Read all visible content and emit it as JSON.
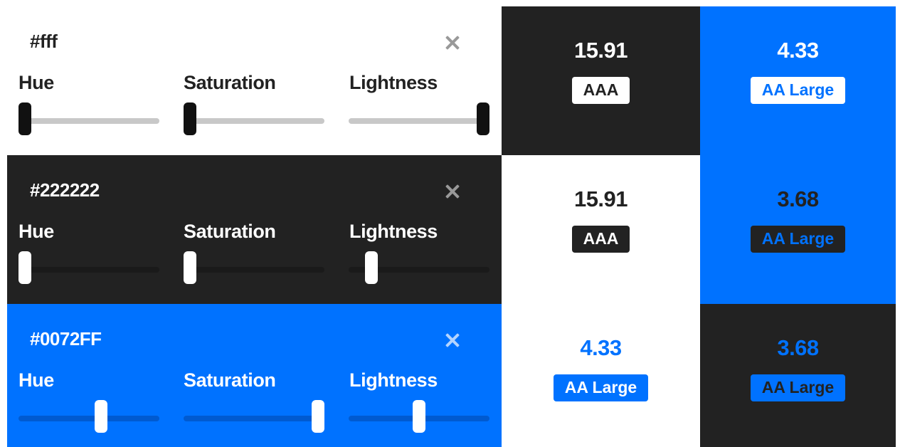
{
  "slider_labels": {
    "hue": "Hue",
    "saturation": "Saturation",
    "lightness": "Lightness"
  },
  "colors": [
    {
      "hex": "#fff",
      "background": "#ffffff",
      "text_color": "#222222",
      "close_color": "#999999",
      "track_color": "#c8c8c8",
      "thumb_color": "#111111",
      "hue": 0,
      "saturation": 0,
      "lightness": 100
    },
    {
      "hex": "#222222",
      "background": "#222222",
      "text_color": "#ffffff",
      "close_color": "#999999",
      "track_color": "#1a1a1a",
      "thumb_color": "#ffffff",
      "hue": 0,
      "saturation": 0,
      "lightness": 13
    },
    {
      "hex": "#0072FF",
      "background": "#0072ff",
      "text_color": "#ffffff",
      "close_color": "#b3d4ff",
      "track_color": "#005ad0",
      "thumb_color": "#ffffff",
      "hue": 213,
      "saturation": 100,
      "lightness": 50
    }
  ],
  "contrast_grid": [
    {
      "ratio": "15.91",
      "badge": "AAA",
      "background": "#222222",
      "text_color": "#ffffff",
      "badge_background": "#ffffff",
      "badge_text": "#222222"
    },
    {
      "ratio": "4.33",
      "badge": "AA Large",
      "background": "#0072ff",
      "text_color": "#ffffff",
      "badge_background": "#ffffff",
      "badge_text": "#0072ff"
    },
    {
      "ratio": "15.91",
      "badge": "AAA",
      "background": "#ffffff",
      "text_color": "#222222",
      "badge_background": "#222222",
      "badge_text": "#ffffff"
    },
    {
      "ratio": "3.68",
      "badge": "AA Large",
      "background": "#0072ff",
      "text_color": "#222222",
      "badge_background": "#222222",
      "badge_text": "#0072ff"
    },
    {
      "ratio": "4.33",
      "badge": "AA Large",
      "background": "#ffffff",
      "text_color": "#0072ff",
      "badge_background": "#0072ff",
      "badge_text": "#ffffff"
    },
    {
      "ratio": "3.68",
      "badge": "AA Large",
      "background": "#222222",
      "text_color": "#0072ff",
      "badge_background": "#0072ff",
      "badge_text": "#222222"
    }
  ]
}
